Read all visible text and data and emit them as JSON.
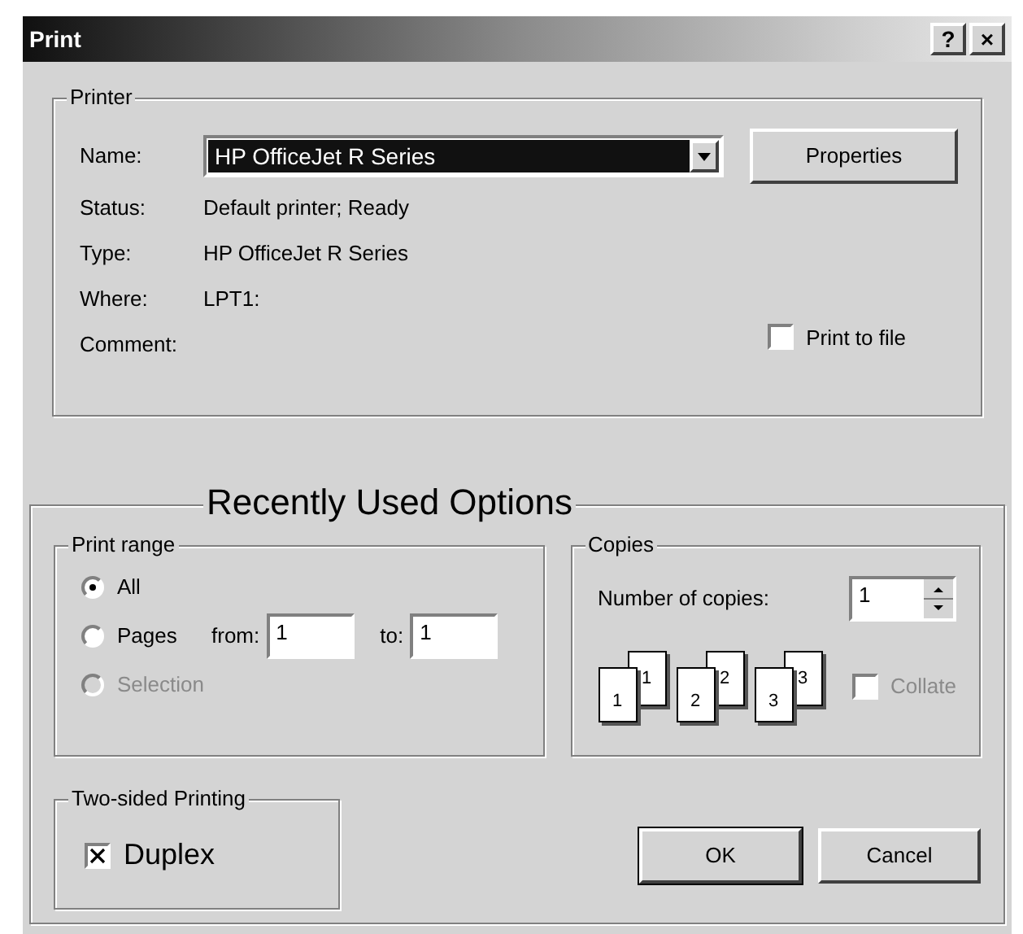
{
  "window": {
    "title": "Print",
    "buttons": [
      "?",
      "×"
    ]
  },
  "printer": {
    "legend": "Printer",
    "name_label": "Name:",
    "name_value": "HP OfficeJet R Series",
    "properties_button": "Properties",
    "info": [
      {
        "label": "Status:",
        "value": "Default printer; Ready"
      },
      {
        "label": "Type:",
        "value": "HP OfficeJet R Series"
      },
      {
        "label": "Where:",
        "value": "LPT1:"
      },
      {
        "label": "Comment:"
      }
    ],
    "print_to_file": {
      "label": "Print to file",
      "checked": false
    }
  },
  "recent": {
    "legend": "Recently Used Options",
    "print_range": {
      "legend": "Print range",
      "options": [
        {
          "label": "All",
          "selected": true,
          "disabled": false
        },
        {
          "label": "Pages",
          "selected": false,
          "disabled": false
        },
        {
          "label": "Selection",
          "selected": false,
          "disabled": true
        }
      ],
      "from_label": "from:",
      "from_value": "1",
      "to_label": "to:",
      "to_value": "1"
    },
    "copies": {
      "legend": "Copies",
      "number_label": "Number of copies:",
      "number_value": "1",
      "pages": [
        {
          "front": "1",
          "back": "1"
        },
        {
          "front": "2",
          "back": "2"
        },
        {
          "front": "3",
          "back": "3"
        }
      ],
      "collate": {
        "label": "Collate",
        "checked": false,
        "disabled": true
      }
    },
    "two_sided": {
      "legend": "Two-sided Printing",
      "duplex": {
        "label": "Duplex",
        "checked": true
      }
    },
    "buttons": [
      {
        "label": "OK",
        "default": true
      },
      {
        "label": "Cancel",
        "default": false
      }
    ]
  }
}
